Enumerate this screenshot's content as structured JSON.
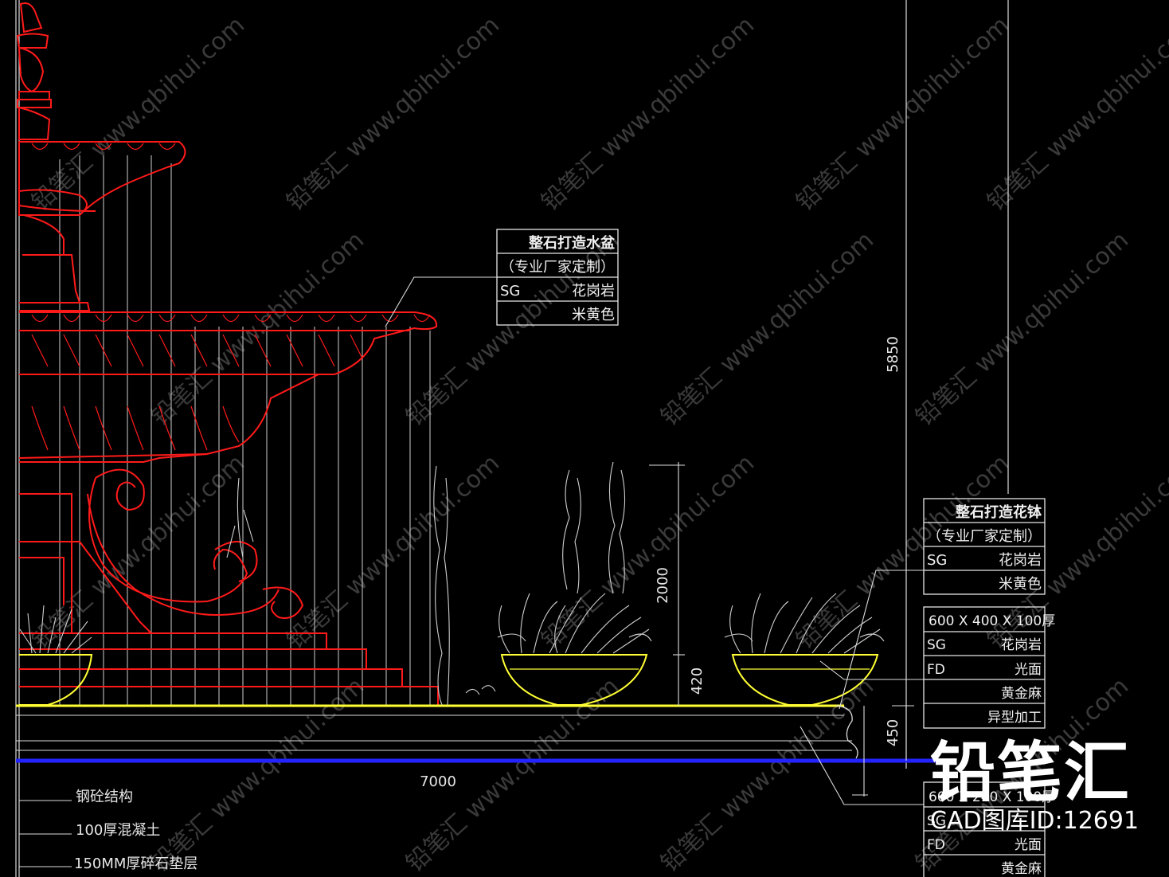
{
  "drawing": {
    "callout_basin": [
      "整石打造水盆",
      "（专业厂家定制）",
      "SG",
      "花岗岩",
      "米黄色"
    ],
    "callout_pot": [
      "整石打造花钵",
      "（专业厂家定制）",
      "SG",
      "花岗岩",
      "米黄色"
    ],
    "callout_step": [
      "600 X 400 X 100厚",
      "SG",
      "花岗岩",
      "FD",
      "光面",
      "黄金麻",
      "异型加工"
    ],
    "callout_lower": [
      "600 X 240 X 100厚",
      "SG",
      "FD",
      "光面",
      "黄金麻"
    ],
    "dimensions": {
      "total_height": "5850",
      "plant_height": "2000",
      "pot_height": "420",
      "step_height": "450",
      "width": "7000"
    },
    "layers": [
      "钢砼结构",
      "100厚混凝土",
      "150MM厚碎石垫层"
    ],
    "watermark": "铅笔汇 www.qbihui.com",
    "colors": {
      "outline": "#ff1a1a",
      "ground": "#ffff33",
      "slab": "#1a1aff",
      "line": "#e6e6e6"
    }
  },
  "brand": {
    "logo": "铅笔汇",
    "id_text": "CAD图库ID:12691"
  }
}
